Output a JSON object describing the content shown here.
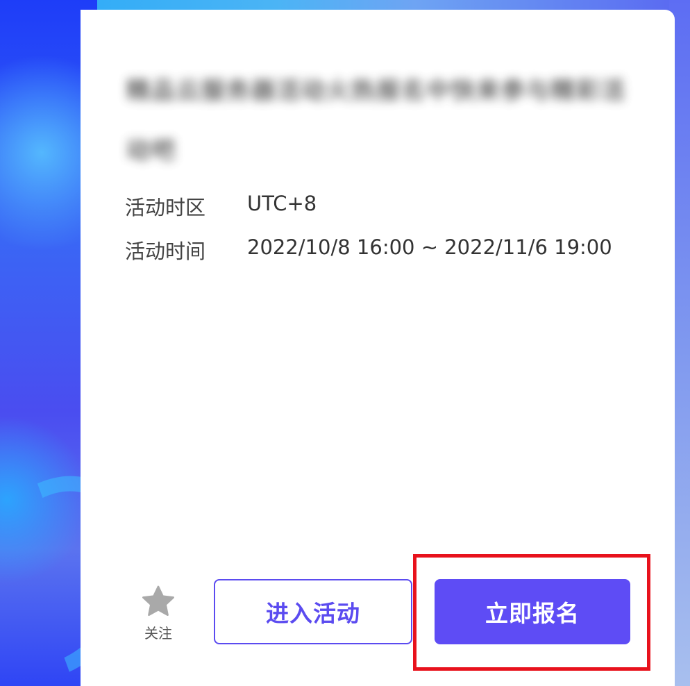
{
  "card": {
    "title_blurred": "精品云服务器活动火热报名中快来参与精彩活动吧",
    "info": [
      {
        "label": "活动时区",
        "value": "UTC+8"
      },
      {
        "label": "活动时间",
        "value": "2022/10/8 16:00 ~ 2022/11/6 19:00"
      }
    ]
  },
  "actions": {
    "follow": {
      "icon": "star-icon",
      "label": "关注"
    },
    "enter_label": "进入活动",
    "signup_label": "立即报名"
  },
  "colors": {
    "accent": "#5e4cf5",
    "highlight": "#e8121c",
    "star": "#a9a9a9"
  }
}
